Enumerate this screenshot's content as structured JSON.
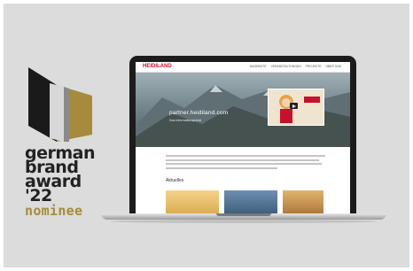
{
  "award": {
    "line1": "german",
    "line2": "brand",
    "line3": "award",
    "line4": "'22",
    "status": "nominee",
    "colors": {
      "dark": "#1e1e1e",
      "gold": "#a58b3b",
      "silver": "#d2d2d2"
    }
  },
  "website": {
    "logo": "HEIDILAND",
    "nav_items": [
      "ANGEBOTE",
      "VERANSTALTUNGEN",
      "PROJEKTE",
      "ÜBER UNS"
    ],
    "hero_title": "partner.heidiland.com",
    "hero_subtitle": "Das Informationsportal",
    "news_heading": "Aktuelles",
    "brand_color": "#c8102e"
  }
}
